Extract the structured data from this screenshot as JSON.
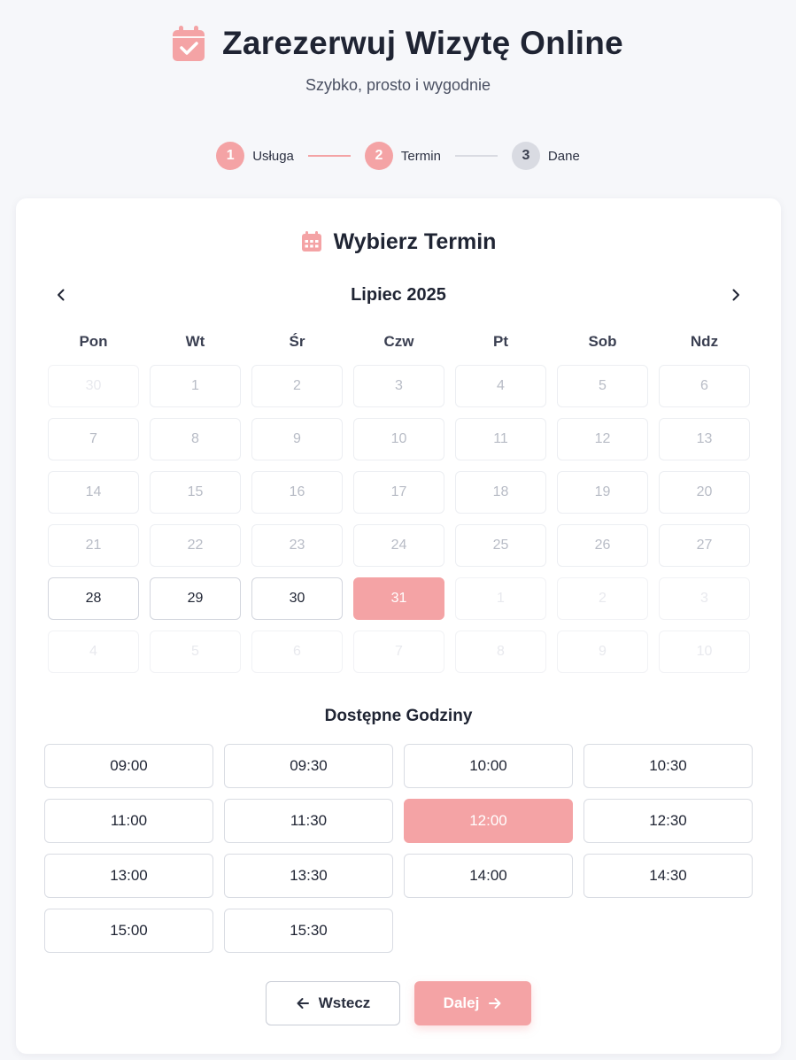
{
  "header": {
    "title": "Zarezerwuj Wizytę Online",
    "subtitle": "Szybko, prosto i wygodnie",
    "icon": "calendar-check-icon"
  },
  "steps": [
    {
      "number": "1",
      "label": "Usługa",
      "state": "done"
    },
    {
      "number": "2",
      "label": "Termin",
      "state": "active"
    },
    {
      "number": "3",
      "label": "Dane",
      "state": "inactive"
    }
  ],
  "colors": {
    "accent": "#f4a3a5",
    "text": "#1f2433",
    "inactive": "#d9dbe2"
  },
  "calendar": {
    "title": "Wybierz Termin",
    "title_icon": "calendar-icon",
    "month": "Lipiec 2025",
    "prev_icon": "chevron-left-icon",
    "next_icon": "chevron-right-icon",
    "weekdays": [
      "Pon",
      "Wt",
      "Śr",
      "Czw",
      "Pt",
      "Sob",
      "Ndz"
    ],
    "days": [
      {
        "d": "30",
        "state": "other"
      },
      {
        "d": "1",
        "state": "disabled"
      },
      {
        "d": "2",
        "state": "disabled"
      },
      {
        "d": "3",
        "state": "disabled"
      },
      {
        "d": "4",
        "state": "disabled"
      },
      {
        "d": "5",
        "state": "disabled"
      },
      {
        "d": "6",
        "state": "disabled"
      },
      {
        "d": "7",
        "state": "disabled"
      },
      {
        "d": "8",
        "state": "disabled"
      },
      {
        "d": "9",
        "state": "disabled"
      },
      {
        "d": "10",
        "state": "disabled"
      },
      {
        "d": "11",
        "state": "disabled"
      },
      {
        "d": "12",
        "state": "disabled"
      },
      {
        "d": "13",
        "state": "disabled"
      },
      {
        "d": "14",
        "state": "disabled"
      },
      {
        "d": "15",
        "state": "disabled"
      },
      {
        "d": "16",
        "state": "disabled"
      },
      {
        "d": "17",
        "state": "disabled"
      },
      {
        "d": "18",
        "state": "disabled"
      },
      {
        "d": "19",
        "state": "disabled"
      },
      {
        "d": "20",
        "state": "disabled"
      },
      {
        "d": "21",
        "state": "disabled"
      },
      {
        "d": "22",
        "state": "disabled"
      },
      {
        "d": "23",
        "state": "disabled"
      },
      {
        "d": "24",
        "state": "disabled"
      },
      {
        "d": "25",
        "state": "disabled"
      },
      {
        "d": "26",
        "state": "disabled"
      },
      {
        "d": "27",
        "state": "disabled"
      },
      {
        "d": "28",
        "state": "available"
      },
      {
        "d": "29",
        "state": "available"
      },
      {
        "d": "30",
        "state": "available"
      },
      {
        "d": "31",
        "state": "selected"
      },
      {
        "d": "1",
        "state": "other"
      },
      {
        "d": "2",
        "state": "other"
      },
      {
        "d": "3",
        "state": "other"
      },
      {
        "d": "4",
        "state": "other"
      },
      {
        "d": "5",
        "state": "other"
      },
      {
        "d": "6",
        "state": "other"
      },
      {
        "d": "7",
        "state": "other"
      },
      {
        "d": "8",
        "state": "other"
      },
      {
        "d": "9",
        "state": "other"
      },
      {
        "d": "10",
        "state": "other"
      }
    ]
  },
  "hours": {
    "title": "Dostępne Godziny",
    "slots": [
      {
        "time": "09:00",
        "selected": false
      },
      {
        "time": "09:30",
        "selected": false
      },
      {
        "time": "10:00",
        "selected": false
      },
      {
        "time": "10:30",
        "selected": false
      },
      {
        "time": "11:00",
        "selected": false
      },
      {
        "time": "11:30",
        "selected": false
      },
      {
        "time": "12:00",
        "selected": true
      },
      {
        "time": "12:30",
        "selected": false
      },
      {
        "time": "13:00",
        "selected": false
      },
      {
        "time": "13:30",
        "selected": false
      },
      {
        "time": "14:00",
        "selected": false
      },
      {
        "time": "14:30",
        "selected": false
      },
      {
        "time": "15:00",
        "selected": false
      },
      {
        "time": "15:30",
        "selected": false
      }
    ]
  },
  "actions": {
    "back_label": "Wstecz",
    "back_icon": "arrow-left-icon",
    "next_label": "Dalej",
    "next_icon": "arrow-right-icon"
  }
}
